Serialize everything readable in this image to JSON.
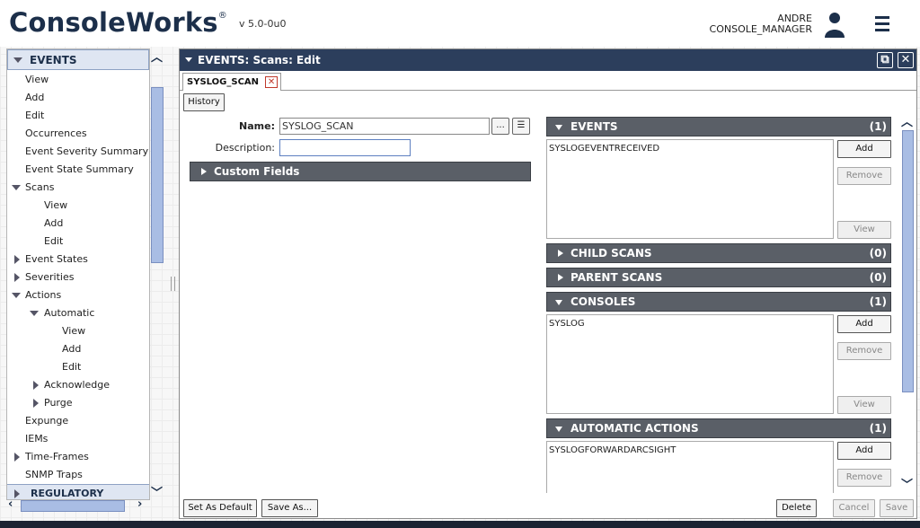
{
  "header": {
    "logo": "ConsoleWorks",
    "logo_mark": "®",
    "version": "v 5.0-0u0",
    "user_name": "ANDRE",
    "user_role": "CONSOLE_MANAGER"
  },
  "sidebar": {
    "section": "EVENTS",
    "footer_section": "REGULATORY",
    "items": [
      {
        "label": "View"
      },
      {
        "label": "Add"
      },
      {
        "label": "Edit"
      },
      {
        "label": "Occurrences"
      },
      {
        "label": "Event Severity Summary"
      },
      {
        "label": "Event State Summary"
      },
      {
        "label": "Scans"
      },
      {
        "label": "View"
      },
      {
        "label": "Add"
      },
      {
        "label": "Edit"
      },
      {
        "label": "Event States"
      },
      {
        "label": "Severities"
      },
      {
        "label": "Actions"
      },
      {
        "label": "Automatic"
      },
      {
        "label": "View"
      },
      {
        "label": "Add"
      },
      {
        "label": "Edit"
      },
      {
        "label": "Acknowledge"
      },
      {
        "label": "Purge"
      },
      {
        "label": "Expunge"
      },
      {
        "label": "IEMs"
      },
      {
        "label": "Time-Frames"
      },
      {
        "label": "SNMP Traps"
      }
    ]
  },
  "panel": {
    "title": "EVENTS: Scans: Edit",
    "tab": "SYSLOG_SCAN",
    "history_button": "History",
    "name_label": "Name:",
    "name_value": "SYSLOG_SCAN",
    "ellipsis_button": "...",
    "description_label": "Description:",
    "description_value": "",
    "custom_fields": "Custom Fields"
  },
  "sections": {
    "events": {
      "title": "EVENTS",
      "count": "(1)",
      "items": [
        "SYSLOGEVENTRECEIVED"
      ]
    },
    "child_scans": {
      "title": "CHILD SCANS",
      "count": "(0)"
    },
    "parent_scans": {
      "title": "PARENT SCANS",
      "count": "(0)"
    },
    "consoles": {
      "title": "CONSOLES",
      "count": "(1)",
      "items": [
        "SYSLOG"
      ]
    },
    "automatic_actions": {
      "title": "AUTOMATIC ACTIONS",
      "count": "(1)",
      "items": [
        "SYSLOGFORWARDARCSIGHT"
      ]
    }
  },
  "list_buttons": {
    "add": "Add",
    "remove": "Remove",
    "view": "View"
  },
  "footer": {
    "set_default": "Set As Default",
    "save_as": "Save As...",
    "delete": "Delete",
    "cancel": "Cancel",
    "save": "Save"
  }
}
